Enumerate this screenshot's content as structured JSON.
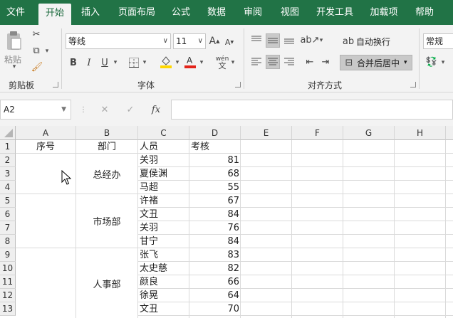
{
  "tabs": [
    "文件",
    "开始",
    "插入",
    "页面布局",
    "公式",
    "数据",
    "审阅",
    "视图",
    "开发工具",
    "加载项",
    "帮助"
  ],
  "clipboard": {
    "paste_label": "粘贴",
    "group_label": "剪贴板"
  },
  "font": {
    "name": "等线",
    "size": "11",
    "group_label": "字体",
    "bold": "B",
    "italic": "I",
    "underline": "U",
    "grow": "A",
    "shrink": "A",
    "fill_color": "#ffd700",
    "font_color": "#e3241a"
  },
  "alignment": {
    "wrap_label": "自动换行",
    "merge_label": "合并后居中",
    "group_label": "对齐方式"
  },
  "number": {
    "format": "常规"
  },
  "name_box": "A2",
  "fx_label": "fx",
  "formula_value": "",
  "columns": [
    "A",
    "B",
    "C",
    "D",
    "E",
    "F",
    "G",
    "H"
  ],
  "row_numbers": [
    "1",
    "2",
    "3",
    "4",
    "5",
    "6",
    "7",
    "8",
    "9",
    "10",
    "11",
    "12",
    "13"
  ],
  "headers": {
    "A": "序号",
    "B": "部门",
    "C": "人员",
    "D": "考核"
  },
  "merged_departments": [
    "总经办",
    "市场部",
    "人事部"
  ],
  "rows": [
    {
      "name": "关羽",
      "score": "81"
    },
    {
      "name": "夏侯渊",
      "score": "68"
    },
    {
      "name": "马超",
      "score": "55"
    },
    {
      "name": "许褚",
      "score": "67"
    },
    {
      "name": "文丑",
      "score": "84"
    },
    {
      "name": "关羽",
      "score": "76"
    },
    {
      "name": "甘宁",
      "score": "84"
    },
    {
      "name": "张飞",
      "score": "83"
    },
    {
      "name": "太史慈",
      "score": "82"
    },
    {
      "name": "颜良",
      "score": "66"
    },
    {
      "name": "徐晃",
      "score": "64"
    },
    {
      "name": "文丑",
      "score": "70"
    }
  ]
}
